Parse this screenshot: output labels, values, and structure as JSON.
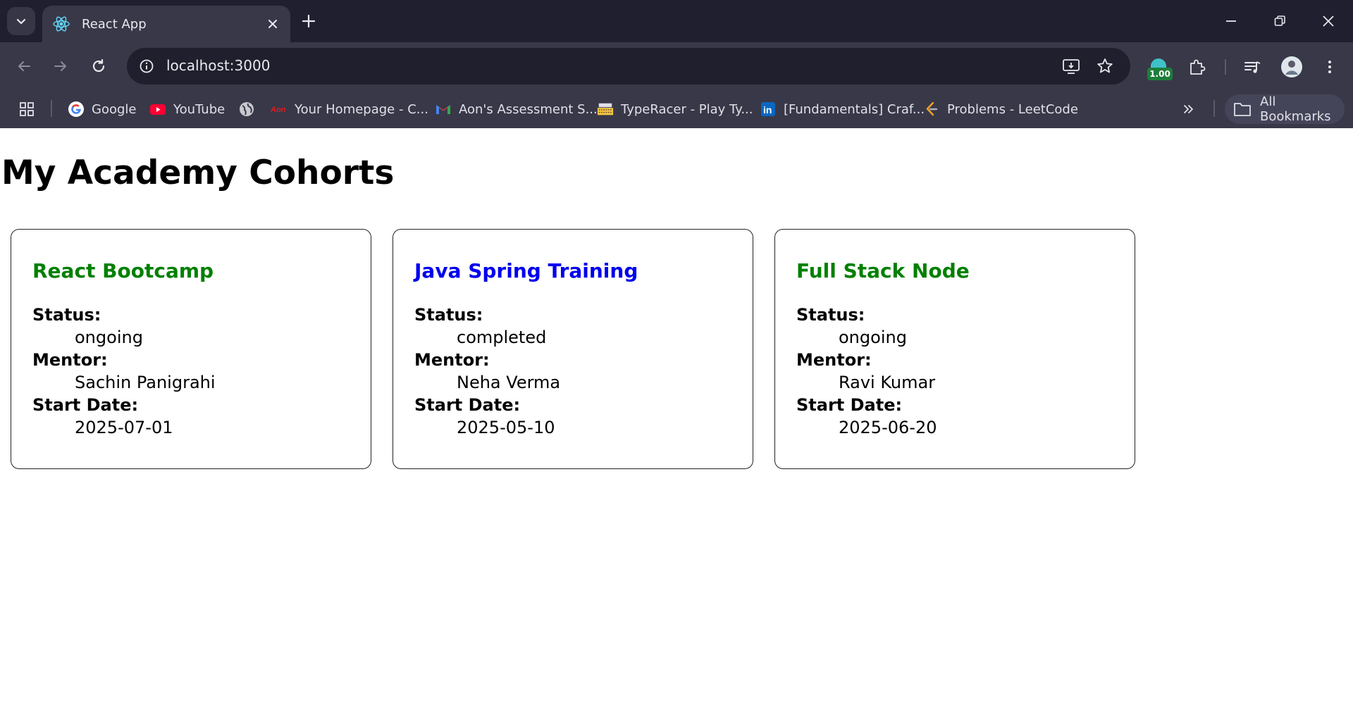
{
  "browser": {
    "tab_title": "React App",
    "url": "localhost:3000",
    "extension_badge": "1.00",
    "bookmarks": [
      {
        "label": "Google",
        "icon": "google-icon"
      },
      {
        "label": "YouTube",
        "icon": "youtube-icon"
      },
      {
        "label": "",
        "icon": "globe-icon"
      },
      {
        "label": "Your Homepage - C...",
        "icon": "aon-icon"
      },
      {
        "label": "Aon's Assessment S...",
        "icon": "gmail-icon"
      },
      {
        "label": "TypeRacer - Play Ty...",
        "icon": "typeracer-icon"
      },
      {
        "label": "[Fundamentals] Craf...",
        "icon": "linkedin-icon"
      },
      {
        "label": "Problems - LeetCode",
        "icon": "leetcode-icon"
      }
    ],
    "all_bookmarks_label": "All Bookmarks"
  },
  "page": {
    "title": "My Academy Cohorts",
    "labels": {
      "status": "Status:",
      "mentor": "Mentor:",
      "start_date": "Start Date:"
    },
    "cohorts": [
      {
        "name": "React Bootcamp",
        "status": "ongoing",
        "mentor": "Sachin Panigrahi",
        "start_date": "2025-07-01",
        "title_color": "#008000"
      },
      {
        "name": "Java Spring Training",
        "status": "completed",
        "mentor": "Neha Verma",
        "start_date": "2025-05-10",
        "title_color": "#0000ee"
      },
      {
        "name": "Full Stack Node",
        "status": "ongoing",
        "mentor": "Ravi Kumar",
        "start_date": "2025-06-20",
        "title_color": "#008000"
      }
    ]
  }
}
